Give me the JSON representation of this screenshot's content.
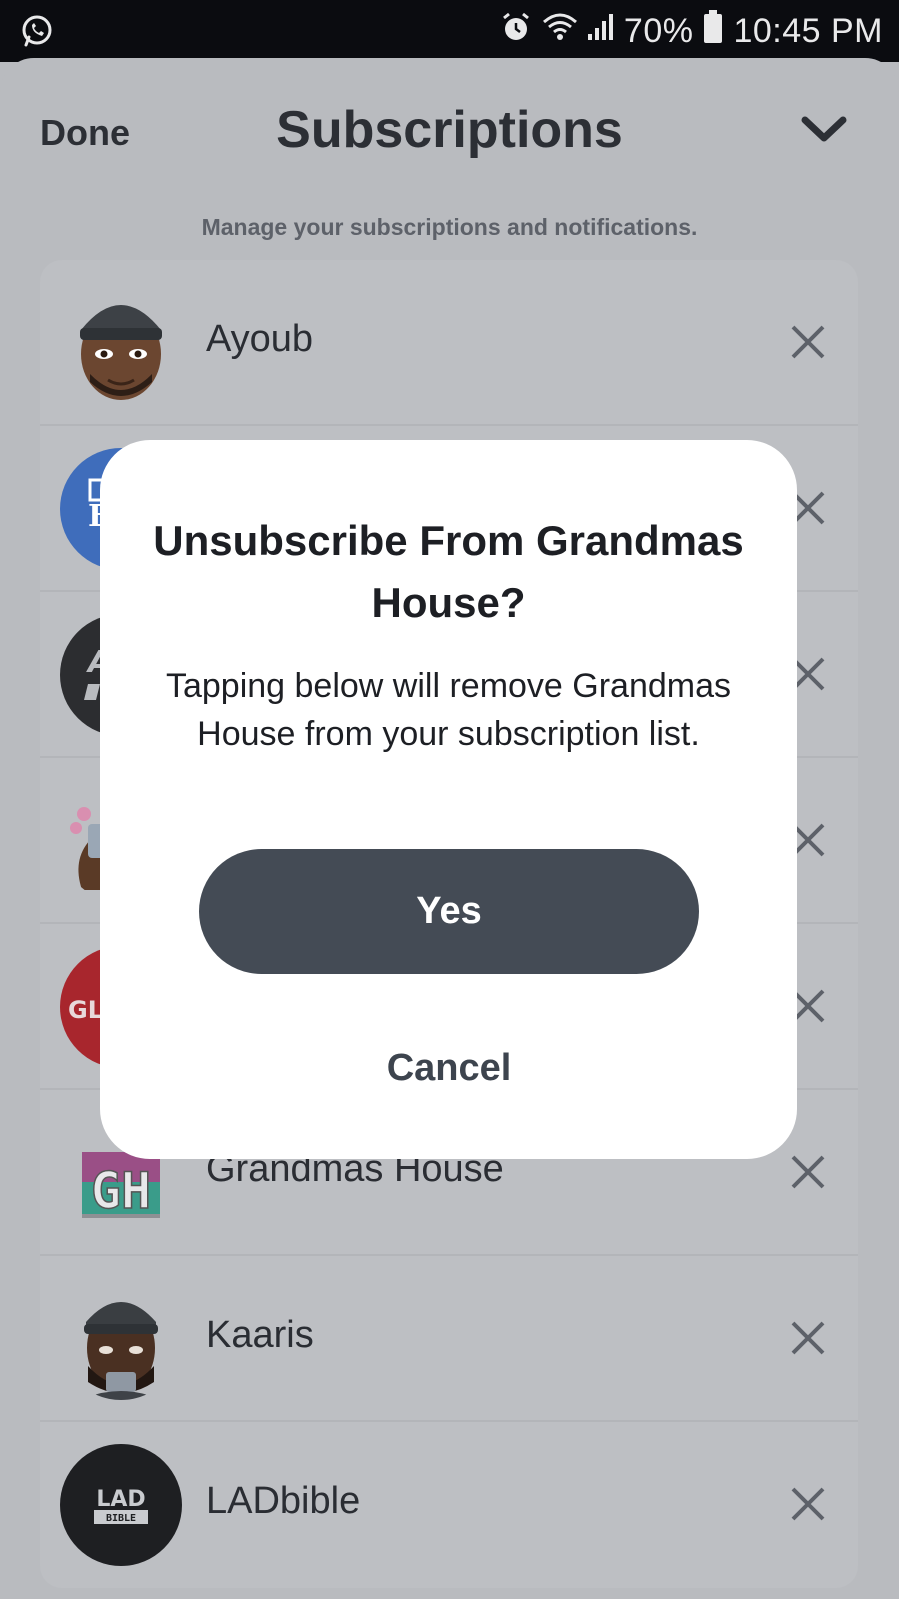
{
  "status_bar": {
    "battery": "70%",
    "time": "10:45 PM"
  },
  "header": {
    "done_label": "Done",
    "title": "Subscriptions",
    "subtitle": "Manage your subscriptions and notifications."
  },
  "subscriptions": [
    {
      "label": "Ayoub"
    },
    {
      "label": ""
    },
    {
      "label": ""
    },
    {
      "label": ""
    },
    {
      "label": ""
    },
    {
      "label": "Grandmas House"
    },
    {
      "label": "Kaaris"
    },
    {
      "label": "LADbible"
    }
  ],
  "avatars": {
    "blue_partial": "E",
    "black_partial": "A",
    "red_partial": "GL",
    "gh": "GH",
    "ladbible_top": "LAD",
    "ladbible_bottom": "BIBLE"
  },
  "dialog": {
    "title": "Unsubscribe From Grandmas House?",
    "body": "Tapping below will remove Grandmas House from your subscription list.",
    "confirm_label": "Yes",
    "cancel_label": "Cancel"
  },
  "colors": {
    "overlay_bg": "#b9bbbf",
    "dialog_bg": "#ffffff",
    "primary_button": "#444b55",
    "text_dark": "#1d1f24"
  }
}
